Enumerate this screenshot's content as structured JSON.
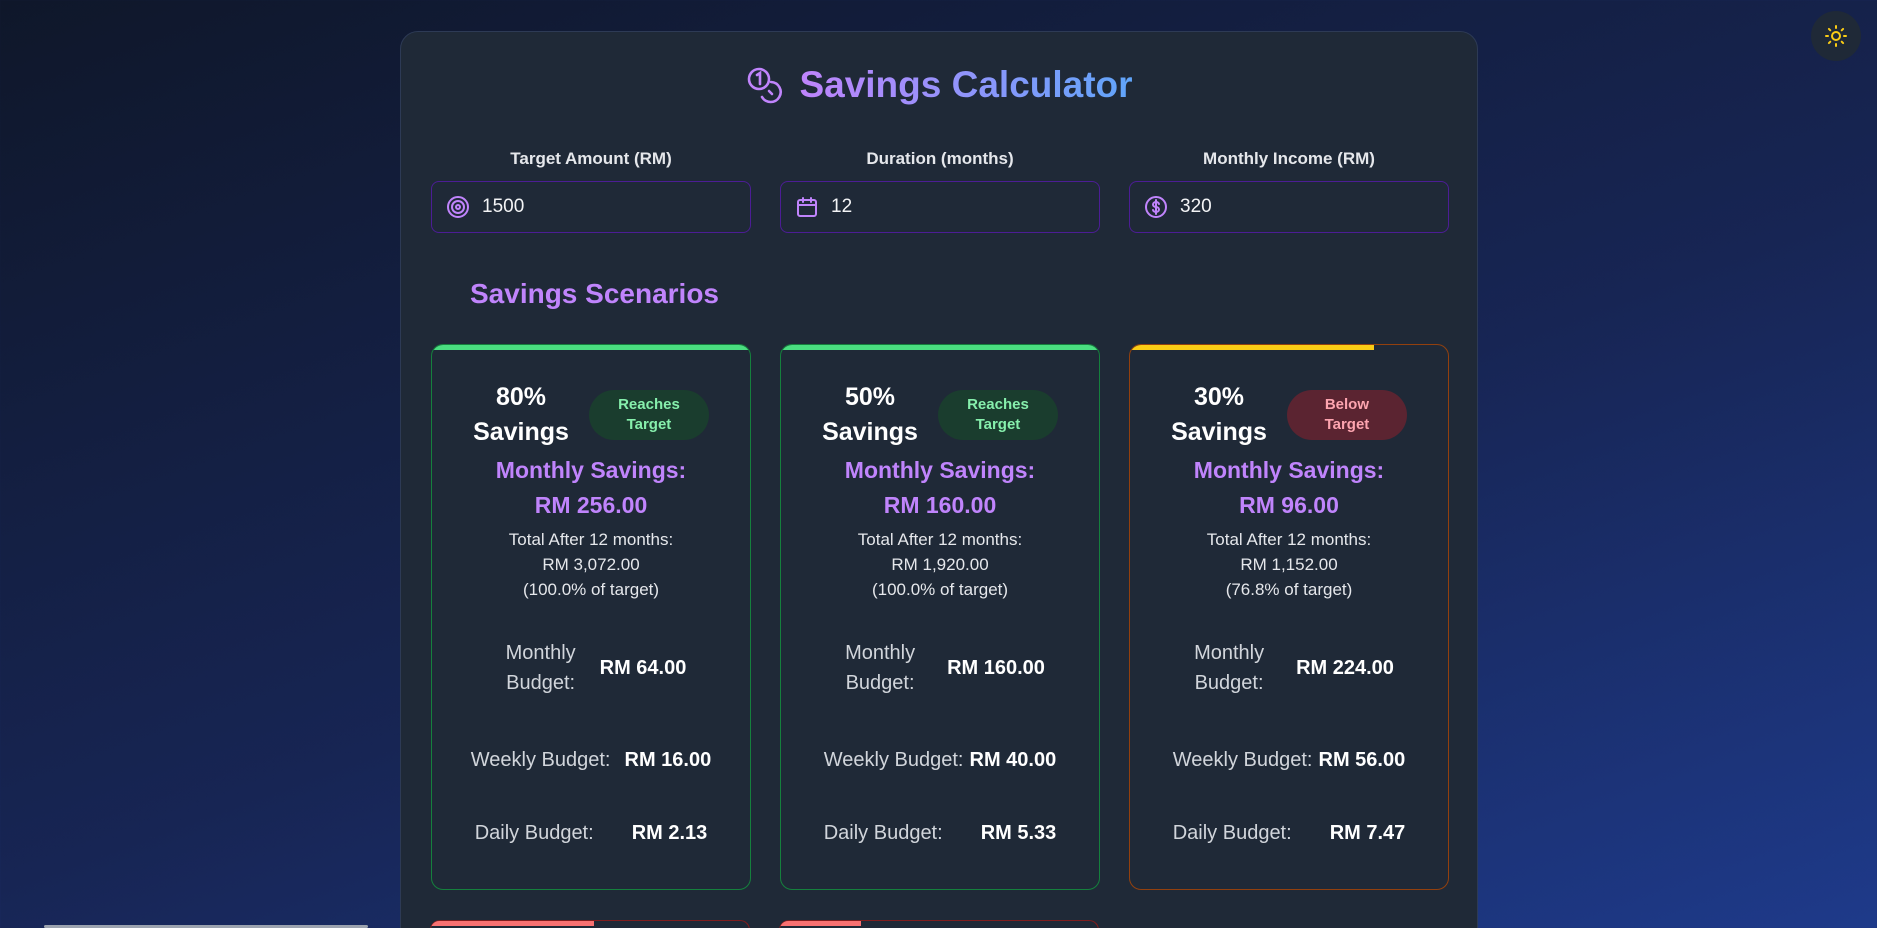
{
  "theme_toggle": {
    "icon": "sun-icon",
    "color": "#facc15"
  },
  "header": {
    "title": "Savings Calculator",
    "icon": "coins-icon"
  },
  "inputs": [
    {
      "label": "Target Amount (RM)",
      "value": "1500",
      "icon": "target-icon"
    },
    {
      "label": "Duration (months)",
      "value": "12",
      "icon": "calendar-icon"
    },
    {
      "label": "Monthly Income (RM)",
      "value": "320",
      "icon": "dollar-circle-icon"
    }
  ],
  "scenarios_title": "Savings Scenarios",
  "scenarios": [
    {
      "pct_line1": "80%",
      "pct_line2": "Savings",
      "badge": "Reaches Target",
      "status": "good",
      "bar_color": "#4ade80",
      "bar_progress": 1.0,
      "monthly_savings_label": "Monthly Savings:",
      "monthly_savings": "RM 256.00",
      "total_label": "Total After 12 months:",
      "total_value": "RM 3,072.00",
      "total_pct": "(100.0% of target)",
      "monthly_budget_label": "Monthly Budget:",
      "monthly_budget": "RM 64.00",
      "weekly_budget_label": "Weekly Budget:",
      "weekly_budget": "RM 16.00",
      "daily_budget_label": "Daily Budget:",
      "daily_budget": "RM 2.13"
    },
    {
      "pct_line1": "50%",
      "pct_line2": "Savings",
      "badge": "Reaches Target",
      "status": "good",
      "bar_color": "#4ade80",
      "bar_progress": 1.0,
      "monthly_savings_label": "Monthly Savings:",
      "monthly_savings": "RM 160.00",
      "total_label": "Total After 12 months:",
      "total_value": "RM 1,920.00",
      "total_pct": "(100.0% of target)",
      "monthly_budget_label": "Monthly Budget:",
      "monthly_budget": "RM 160.00",
      "weekly_budget_label": "Weekly Budget:",
      "weekly_budget": "RM 40.00",
      "daily_budget_label": "Daily Budget:",
      "daily_budget": "RM 5.33"
    },
    {
      "pct_line1": "30%",
      "pct_line2": "Savings",
      "badge": "Below Target",
      "status": "bad",
      "bar_color": "#facc15",
      "bar_progress": 0.768,
      "monthly_savings_label": "Monthly Savings:",
      "monthly_savings": "RM 96.00",
      "total_label": "Total After 12 months:",
      "total_value": "RM 1,152.00",
      "total_pct": "(76.8% of target)",
      "monthly_budget_label": "Monthly Budget:",
      "monthly_budget": "RM 224.00",
      "weekly_budget_label": "Weekly Budget:",
      "weekly_budget": "RM 56.00",
      "daily_budget_label": "Daily Budget:",
      "daily_budget": "RM 7.47"
    }
  ],
  "partial_scenarios": [
    {
      "bar_color": "#f87171",
      "bar_progress": 0.512
    },
    {
      "bar_color": "#f87171",
      "bar_progress": 0.256
    }
  ]
}
